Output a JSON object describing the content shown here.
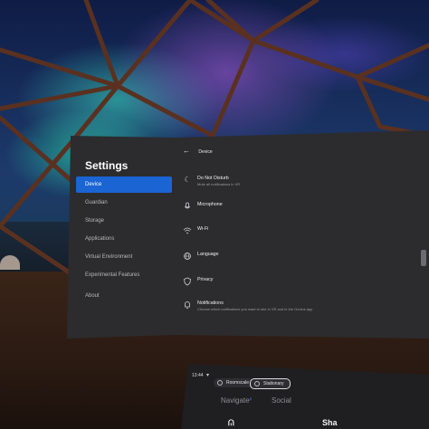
{
  "sidebar": {
    "title": "Settings",
    "items": [
      {
        "label": "Device",
        "active": true
      },
      {
        "label": "Guardian"
      },
      {
        "label": "Storage"
      },
      {
        "label": "Applications"
      },
      {
        "label": "Virtual Environment"
      },
      {
        "label": "Experimental Features"
      },
      {
        "label": "About"
      }
    ]
  },
  "content": {
    "header": "Device",
    "rows": [
      {
        "label": "Do Not Disturb",
        "sub": "Mute all notifications in VR",
        "icon": "moon-icon"
      },
      {
        "label": "Microphone",
        "sub": "",
        "icon": "microphone-icon"
      },
      {
        "label": "Wi-Fi",
        "sub": "",
        "icon": "wifi-icon"
      },
      {
        "label": "Language",
        "sub": "",
        "icon": "globe-icon"
      },
      {
        "label": "Privacy",
        "sub": "",
        "icon": "shield-icon"
      },
      {
        "label": "Notifications",
        "sub": "Choose which notifications you want to see in VR and in the Oculus app",
        "icon": "bell-icon"
      }
    ]
  },
  "bottom_bar": {
    "time": "13:44",
    "boundary_options": [
      "Roomscale",
      "Stationary"
    ],
    "selected_boundary": "Stationary",
    "tabs": [
      "Navigate",
      "Social"
    ],
    "navigate_badge": "β",
    "partial_label": "Sha"
  },
  "colors": {
    "accent": "#1a64d4",
    "panel": "#2c2c2e"
  }
}
